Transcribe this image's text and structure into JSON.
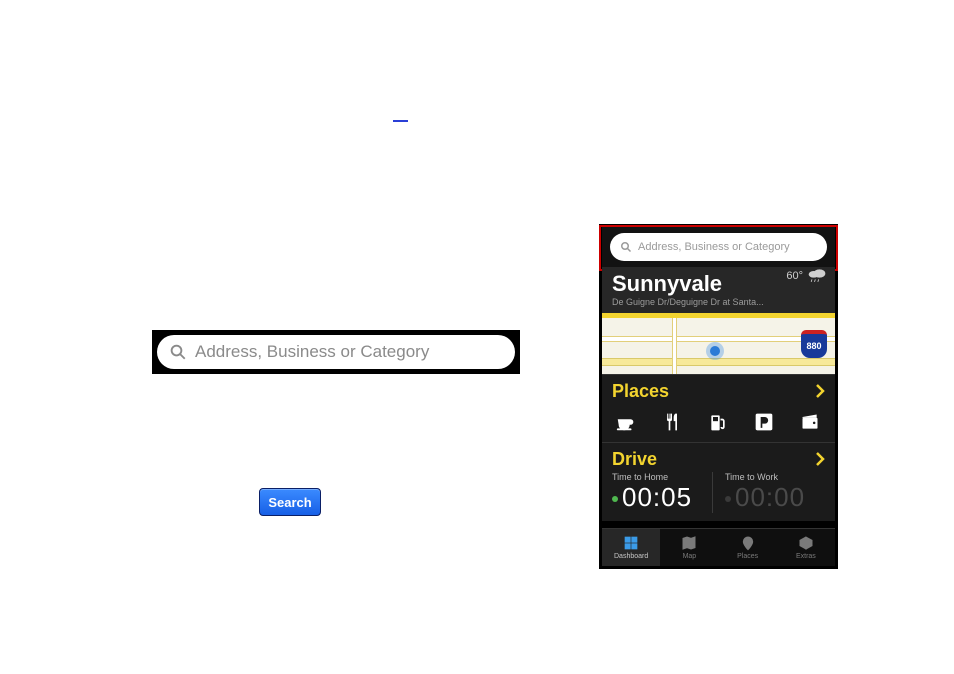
{
  "standalone_search": {
    "placeholder": "Address, Business or Category"
  },
  "blue_button": {
    "label": "Search"
  },
  "phone": {
    "search": {
      "placeholder": "Address, Business or Category"
    },
    "location": {
      "city": "Sunnyvale",
      "subtitle": "De Guigne Dr/Deguigne Dr at Santa...",
      "temp": "60°"
    },
    "map": {
      "highway_shield": "880"
    },
    "places": {
      "title": "Places",
      "icons": [
        "coffee-icon",
        "restaurant-icon",
        "gas-icon",
        "parking-icon",
        "wallet-icon"
      ]
    },
    "drive": {
      "title": "Drive",
      "home": {
        "label": "Time to Home",
        "value": "00:05",
        "active": true
      },
      "work": {
        "label": "Time to Work",
        "value": "00:00",
        "active": false
      }
    },
    "tabs": [
      {
        "label": "Dashboard",
        "active": true
      },
      {
        "label": "Map",
        "active": false
      },
      {
        "label": "Places",
        "active": false
      },
      {
        "label": "Extras",
        "active": false
      }
    ]
  }
}
